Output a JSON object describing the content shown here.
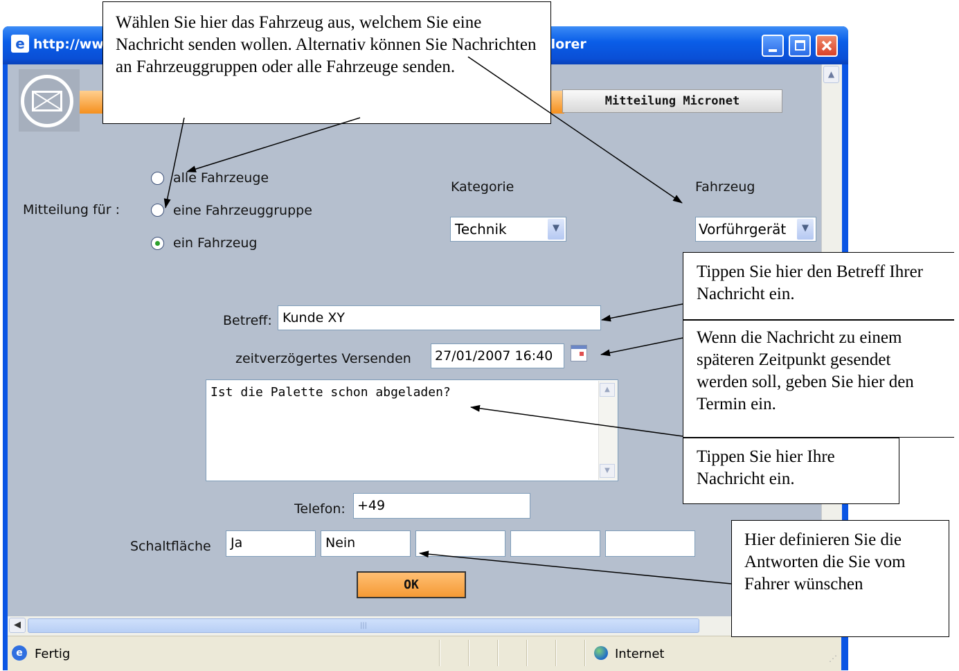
{
  "window": {
    "title_left": "http://ww",
    "title_right": "plorer",
    "ie_icon": "ie-logo-icon",
    "controls": [
      "minimize-icon",
      "maximize-icon",
      "close-icon"
    ]
  },
  "header": {
    "tab_label": "Mitteilung Micronet",
    "icon": "envelope-icon"
  },
  "form": {
    "mitteilung_label": "Mitteilung für :",
    "radio_options": [
      {
        "label": "alle Fahrzeuge",
        "selected": false
      },
      {
        "label": "eine Fahrzeuggruppe",
        "selected": false
      },
      {
        "label": "ein Fahrzeug",
        "selected": true
      }
    ],
    "kategorie_label": "Kategorie",
    "kategorie_value": "Technik",
    "fahrzeug_label": "Fahrzeug",
    "fahrzeug_value": "Vorführgerät",
    "betreff_label": "Betreff:",
    "betreff_value": "Kunde XY",
    "versenden_label": "zeitverzögertes Versenden",
    "versenden_value": "27/01/2007 16:40",
    "message_text": "Ist die Palette schon abgeladen?",
    "telefon_label": "Telefon:",
    "telefon_value": "+49",
    "schaltflaeche_label": "Schaltfläche",
    "buttons": [
      "Ja",
      "Nein",
      "",
      "",
      ""
    ],
    "ok_label": "OK"
  },
  "statusbar": {
    "status_text": "Fertig",
    "zone_text": "Internet"
  },
  "callouts": {
    "top": "Wählen Sie hier das Fahrzeug aus, welchem Sie eine Nachricht senden wollen. Alternativ können Sie Nachrichten an Fahrzeuggruppen oder alle Fahrzeuge senden.",
    "betreff": "Tippen Sie hier den Betreff Ihrer Nachricht ein.",
    "termin": "Wenn die Nachricht zu einem späteren Zeitpunkt gesendet werden soll, geben Sie hier den Termin ein.",
    "nachricht": "Tippen Sie hier Ihre Nachricht ein.",
    "antworten": "Hier definieren Sie die Antworten die Sie vom Fahrer wünschen"
  }
}
